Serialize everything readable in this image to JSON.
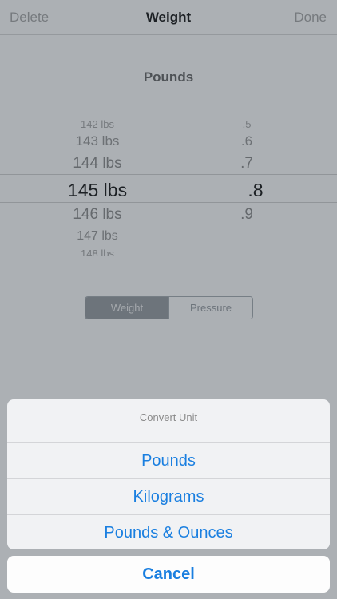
{
  "navbar": {
    "left": "Delete",
    "title": "Weight",
    "right": "Done"
  },
  "unit_title": "Pounds",
  "picker": {
    "rows": [
      {
        "a": "142 lbs",
        "b": ".5"
      },
      {
        "a": "143 lbs",
        "b": ".6"
      },
      {
        "a": "144 lbs",
        "b": ".7"
      },
      {
        "a": "145 lbs",
        "b": ".8"
      },
      {
        "a": "146 lbs",
        "b": ".9"
      },
      {
        "a": "147 lbs",
        "b": ""
      },
      {
        "a": "148 lbs",
        "b": ""
      }
    ]
  },
  "segmented": {
    "active": "Weight",
    "inactive": "Pressure"
  },
  "action_sheet": {
    "title": "Convert Unit",
    "items": [
      "Pounds",
      "Kilograms",
      "Pounds & Ounces"
    ],
    "cancel": "Cancel"
  }
}
